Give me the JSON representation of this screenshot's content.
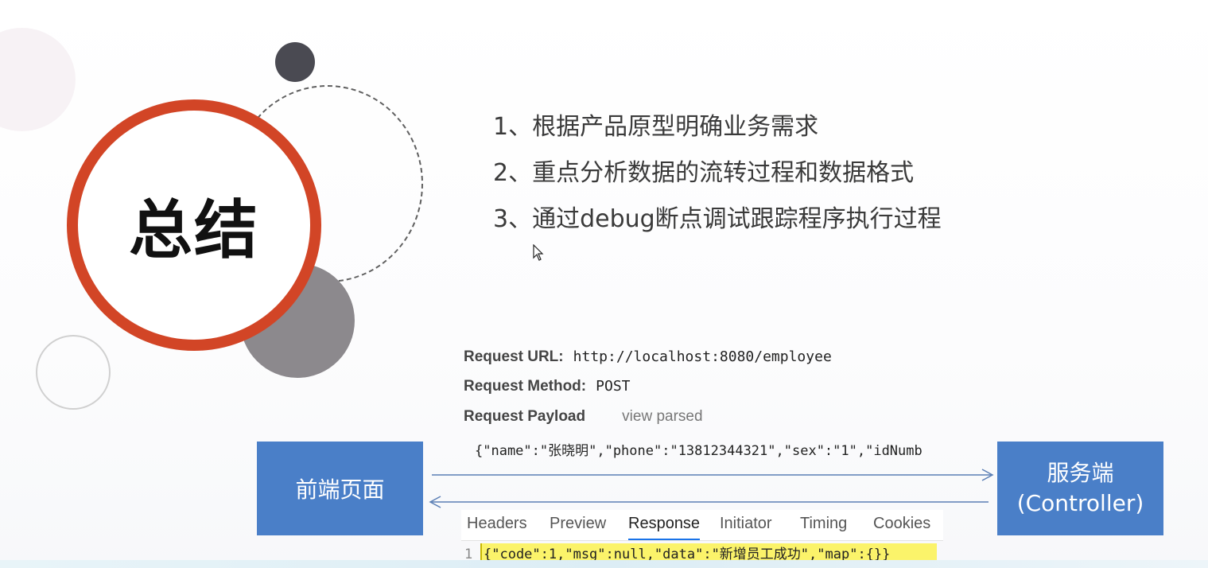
{
  "slide": {
    "title": "总结",
    "points": [
      "1、根据产品原型明确业务需求",
      "2、重点分析数据的流转过程和数据格式",
      "3、通过debug断点调试跟踪程序执行过程"
    ]
  },
  "request": {
    "url_label": "Request URL:",
    "url_value": "http://localhost:8080/employee",
    "method_label": "Request Method:",
    "method_value": "POST",
    "payload_label": "Request Payload",
    "view_parsed": "view parsed",
    "payload_value": "{\"name\":\"张晓明\",\"phone\":\"13812344321\",\"sex\":\"1\",\"idNumb"
  },
  "diagram": {
    "frontend_label": "前端页面",
    "server_label_1": "服务端",
    "server_label_2": "(Controller)"
  },
  "devtools_tabs": [
    "Headers",
    "Preview",
    "Response",
    "Initiator",
    "Timing",
    "Cookies"
  ],
  "active_tab": "Response",
  "response": {
    "line_number": "1",
    "body": "{\"code\":1,\"msg\":null,\"data\":\"新增员工成功\",\"map\":{}}"
  },
  "colors": {
    "accent_red": "#d24526",
    "box_blue": "#4a7fc8",
    "highlight_yellow": "#fbf36a"
  }
}
